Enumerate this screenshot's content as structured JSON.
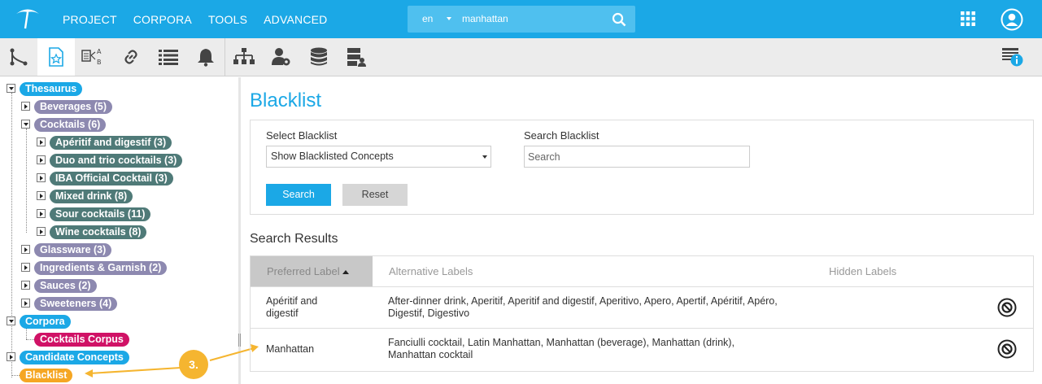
{
  "topbar": {
    "menu": [
      "PROJECT",
      "CORPORA",
      "TOOLS",
      "ADVANCED"
    ],
    "search": {
      "language": "en",
      "query": "manhattan"
    }
  },
  "tree": {
    "thesaurus": "Thesaurus",
    "beverages": "Beverages (5)",
    "cocktails": "Cocktails (6)",
    "aperitif": "Apéritif and digestif (3)",
    "duo": "Duo and trio cocktails (3)",
    "iba": "IBA Official Cocktail (3)",
    "mixed": "Mixed drink (8)",
    "sour": "Sour cocktails (11)",
    "wine": "Wine cocktails (8)",
    "glassware": "Glassware (3)",
    "ingredients": "Ingredients & Garnish (2)",
    "sauces": "Sauces (2)",
    "sweeteners": "Sweeteners (4)",
    "corpora": "Corpora",
    "cocktails_corpus": "Cocktails Corpus",
    "candidate": "Candidate Concepts",
    "blacklist": "Blacklist"
  },
  "annotation": {
    "step": "3."
  },
  "main": {
    "title": "Blacklist",
    "select_label": "Select Blacklist",
    "select_value": "Show Blacklisted Concepts",
    "search_label": "Search Blacklist",
    "search_placeholder": "Search",
    "search_button": "Search",
    "reset_button": "Reset",
    "results_title": "Search Results",
    "columns": [
      "Preferred Label",
      "Alternative Labels",
      "Hidden Labels"
    ],
    "rows": [
      {
        "preferred": [
          "Apéritif and",
          "digestif"
        ],
        "alternative": [
          "After-dinner drink, Aperitif, Aperitif and digestif, Aperitivo, Apero, Apertif, Apéritif, Apéro,",
          "Digestif, Digestivo"
        ],
        "hidden": ""
      },
      {
        "preferred": [
          "Manhattan"
        ],
        "alternative": [
          "Fanciulli cocktail, Latin Manhattan, Manhattan (beverage), Manhattan (drink),",
          "Manhattan cocktail"
        ],
        "hidden": ""
      }
    ]
  },
  "colors": {
    "accent": "#1ba8e6",
    "concept_scheme": "#8d89b0",
    "concept": "#4f7a78",
    "corpus": "#d01266",
    "blacklist": "#f5a623"
  }
}
